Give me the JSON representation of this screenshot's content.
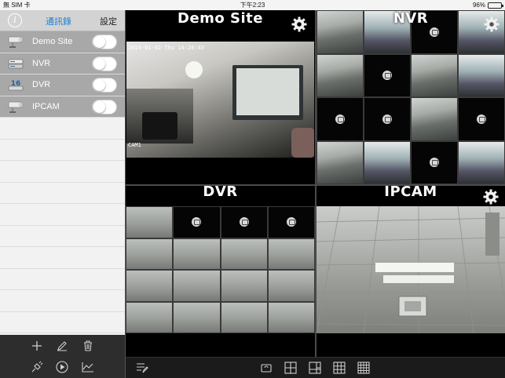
{
  "status_bar": {
    "carrier": "無 SIM 卡",
    "time": "下午2:23",
    "battery": "96%",
    "battery_level": 0.96
  },
  "sidebar": {
    "tabs": {
      "contacts": "通訊錄",
      "settings": "設定"
    },
    "devices": [
      {
        "label": "Demo Site",
        "icon": "camera-icon",
        "enabled": false
      },
      {
        "label": "NVR",
        "icon": "nvr-icon",
        "enabled": false
      },
      {
        "label": "DVR",
        "icon": "dvr-16-icon",
        "enabled": false
      },
      {
        "label": "IPCAM",
        "icon": "camera-icon",
        "enabled": false
      }
    ],
    "dvr_icon_badge": "16",
    "toolbar_icons": [
      "add-icon",
      "edit-icon",
      "trash-icon",
      "satellite-icon",
      "play-icon",
      "chart-icon"
    ]
  },
  "panels": {
    "demo_site": {
      "title": "Demo Site",
      "timestamp": "2014-01-02 Thu 14:28:43",
      "camera_label": "CAM1"
    },
    "nvr": {
      "title": "NVR"
    },
    "dvr": {
      "title": "DVR"
    },
    "ipcam": {
      "title": "IPCAM"
    }
  },
  "bottom_toolbar_icons": [
    "list-edit-icon",
    "rotate-camera-icon",
    "layout-2x2-icon",
    "layout-1plus3-icon",
    "layout-3x3-icon",
    "layout-4x4-icon"
  ],
  "colors": {
    "accent": "#1a7fd4",
    "sidebar_row": "#a8a8a8",
    "toolbar": "#2d2d2d"
  }
}
